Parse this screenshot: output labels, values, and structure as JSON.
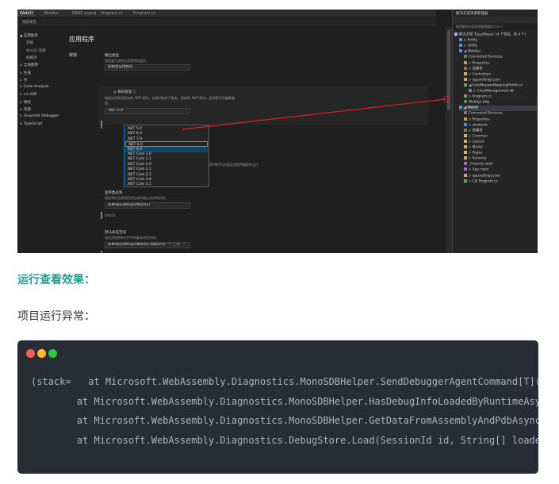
{
  "screenshot": {
    "tabs": [
      "WebUI",
      "WebApi",
      "RBAC.csproj",
      "Program.cs",
      "Program.cs"
    ],
    "search_placeholder": "搜索属性",
    "left_nav": [
      {
        "label": "▲ 应用程序",
        "level": 0
      },
      {
        "label": "常规",
        "level": 1
      },
      {
        "label": "Win32 资源",
        "level": 1
      },
      {
        "label": "依赖项",
        "level": 1
      },
      {
        "label": "▷ 全局使用",
        "level": 0
      },
      {
        "label": "▷ 生成",
        "level": 0
      },
      {
        "label": "▷ 包",
        "level": 0
      },
      {
        "label": "▷ Code Analysis",
        "level": 0
      },
      {
        "label": "▷ Lin Q师",
        "level": 0
      },
      {
        "label": "▷ 调试",
        "level": 0
      },
      {
        "label": "▷ 资源",
        "level": 0
      },
      {
        "label": "▷ Snapshot Debugger",
        "level": 0
      },
      {
        "label": "▷ TypeScript",
        "level": 0
      }
    ],
    "page_title": "应用程序",
    "section_label": "常规",
    "output_type": {
      "label": "输出类型",
      "description": "指定要生成的应用程序的类型。",
      "value": "控制台应用程序"
    },
    "target_framework": {
      "label": "◎ 目标框架 ⓘ",
      "description": "指定应用程序面向的 .NET 版本。若要切换多个版本，请选择 .NET 版本，此时将打开编辑器。",
      "description2": "此。",
      "value": ".NET 6.0",
      "options": [
        ".NET 5.0",
        ".NET 6.0",
        ".NET 7.0",
        ".NET 8.0",
        ".NET 9.0",
        ".NET Core 1.0",
        ".NET Core 1.1",
        ".NET Core 2.0",
        ".NET Core 2.1",
        ".NET Core 2.2",
        ".NET Core 3.0",
        ".NET Core 3.1"
      ],
      "selected_index": 4,
      "hover_index": 3
    },
    "side_note": "此应用程序将作为托管应用程序管理并运行",
    "assembly_name": {
      "label": "程序集名称",
      "description": "指定将在生成项目时生成的输出文件的名称。",
      "value": "$(MSBuildProjectName)",
      "preview": "WebUI"
    },
    "default_namespace": {
      "label": "默认命名空间",
      "description": "指定添加到新文件中的基本命名空间。",
      "value": "$(MSBuildProjectName.Replace(\" \", \"_\"))",
      "preview": "WebUI"
    },
    "solution_explorer": {
      "title": "解决方案资源管理器",
      "search_placeholder": "搜索解决方案资源管理器(Ctrl+;)",
      "items": [
        {
          "label": "解决方案 'EasyBlazor' (4 个项目，共 4 个)",
          "level": 0,
          "color": "#c3a5e8"
        },
        {
          "label": "▷ Entity",
          "level": 1,
          "color": "#4e8fd6"
        },
        {
          "label": "▷ Utility",
          "level": 1,
          "color": "#4e8fd6"
        },
        {
          "label": "◢ WebApi",
          "level": 1,
          "color": "#4e8fd6"
        },
        {
          "label": "Connected Services",
          "level": 2,
          "color": "#7a7a7a"
        },
        {
          "label": "▷ Properties",
          "level": 2,
          "color": "#c9a343"
        },
        {
          "label": "▷ 依赖项",
          "level": 2,
          "color": "#7a7a7a"
        },
        {
          "label": "▷ Controllers",
          "level": 2,
          "color": "#dcb14f"
        },
        {
          "label": "▷ appsettings.json",
          "level": 2,
          "color": "#d6a94c"
        },
        {
          "label": "◢ AutoMapperMappingProfile.cs",
          "level": 2,
          "color": "#68a75f"
        },
        {
          "label": "▷ ClassManagement.db",
          "level": 3,
          "color": "#7a7a7a"
        },
        {
          "label": "▷ Program.cs",
          "level": 2,
          "color": "#68a75f"
        },
        {
          "label": "WebApi.http",
          "level": 2,
          "color": "#7a7a7a"
        },
        {
          "label": "◢ WebUI",
          "level": 1,
          "color": "#4e8fd6",
          "selected": true
        },
        {
          "label": "Connected Services",
          "level": 2,
          "color": "#7a7a7a"
        },
        {
          "label": "▷ Properties",
          "level": 2,
          "color": "#c9a343"
        },
        {
          "label": "▷ wwwroot",
          "level": 2,
          "color": "#4e8fd6"
        },
        {
          "label": "▷ 依赖项",
          "level": 2,
          "color": "#7a7a7a"
        },
        {
          "label": "▷ Common",
          "level": 2,
          "color": "#dcb14f"
        },
        {
          "label": "▷ Layout",
          "level": 2,
          "color": "#dcb14f"
        },
        {
          "label": "▷ Model",
          "level": 2,
          "color": "#dcb14f"
        },
        {
          "label": "▷ Pages",
          "level": 2,
          "color": "#dcb14f"
        },
        {
          "label": "▷ Services",
          "level": 2,
          "color": "#dcb14f"
        },
        {
          "label": "_Imports.razor",
          "level": 2,
          "color": "#9b6cd9"
        },
        {
          "label": "▷ App.razor",
          "level": 2,
          "color": "#9b6cd9"
        },
        {
          "label": "▷ appsettings.json",
          "level": 2,
          "color": "#d6a94c"
        },
        {
          "label": "▷ C# Program.cs",
          "level": 2,
          "color": "#68a75f"
        }
      ]
    }
  },
  "article": {
    "heading": "运行查看效果：",
    "paragraph": "项目运行异常：",
    "code": {
      "dot_colors": [
        "#fe5f57",
        "#febc2e",
        "#28c840"
      ],
      "lines": [
        {
          "text": "(stack=   at Microsoft.WebAssembly.Diagnostics.MonoSDBHelper.SendDebuggerAgentCommand[T](T ",
          "keyword": "command"
        },
        {
          "text": "        at Microsoft.WebAssembly.Diagnostics.MonoSDBHelper.HasDebugInfoLoadedByRuntimeAsync(Strin",
          "keyword": ""
        },
        {
          "text": "        at Microsoft.WebAssembly.Diagnostics.MonoSDBHelper.GetDataFromAssemblyAndPdbAsync(String",
          "keyword": ""
        },
        {
          "text": "        at Microsoft.WebAssembly.Diagnostics.DebugStore.Load(SessionId id, String[] loaded_files",
          "keyword": ""
        }
      ]
    }
  }
}
